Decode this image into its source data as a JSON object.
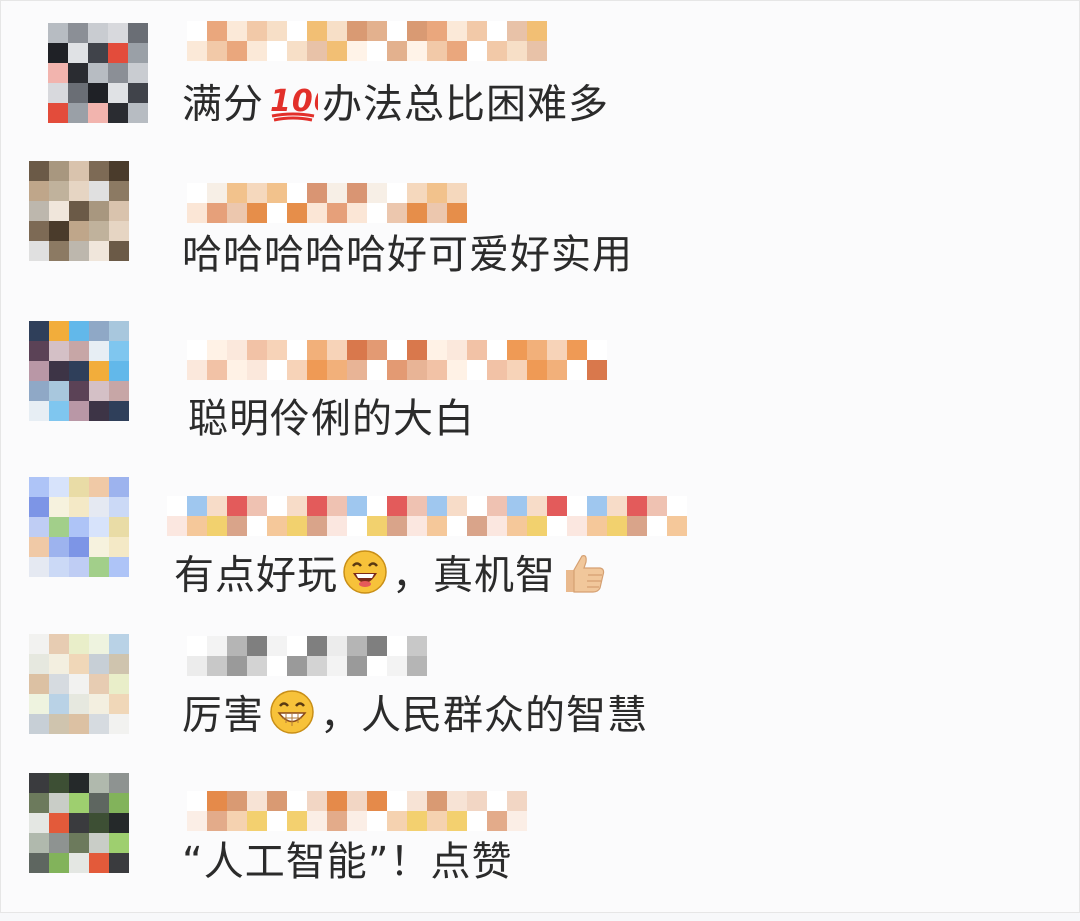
{
  "comments": [
    {
      "text_before": "满分",
      "emoji": "hundred-points",
      "text_after": "办法总比困难多"
    },
    {
      "text_before": "哈哈哈哈哈好可爱好实用",
      "emoji": "",
      "text_after": ""
    },
    {
      "text_before": "聪明伶俐的大白",
      "emoji": "",
      "text_after": ""
    },
    {
      "text_before": "有点好玩",
      "emoji": "laughing-face",
      "text_after": "，真机智",
      "emoji2": "thumbs-up"
    },
    {
      "text_before": "厉害",
      "emoji": "grinning-face",
      "text_after": "，人民群众的智慧"
    },
    {
      "text_before": "“人工智能”！点赞",
      "emoji": "",
      "text_after": ""
    }
  ],
  "colors": {
    "text": "#2b2b2b",
    "background": "#fbfbfc",
    "emoji_yellow": "#f7c23a",
    "hundred_red": "#e2302a",
    "thumb_skin": "#f1c79b"
  },
  "avatar_palettes": [
    [
      "#b7bcc2",
      "#1f2126",
      "#40434a",
      "#9aa0a7",
      "#c9ccd1",
      "#6a6e75",
      "#e0e2e5",
      "#2a2c31",
      "#8b8f96",
      "#d8d9dd",
      "#e34c3b",
      "#f2b4ae"
    ],
    [
      "#6b5a47",
      "#bfa68a",
      "#e6d5c3",
      "#8c7a63",
      "#d9c3ad",
      "#4a3b2b",
      "#c0b29c",
      "#f0e6db",
      "#a8977f",
      "#7d6a55",
      "#e0e0e0",
      "#bdb7ad"
    ],
    [
      "#2f3f5a",
      "#5b4256",
      "#c7a6a6",
      "#7fc6ef",
      "#62b8ea",
      "#a8c7dd",
      "#d4c0c6",
      "#3d3446",
      "#f2ad3b",
      "#8fa8c6",
      "#e7eef4",
      "#b997a6"
    ],
    [
      "#aec4f7",
      "#7d95e6",
      "#f4e9c6",
      "#cbd9f6",
      "#e9dca6",
      "#9db3ee",
      "#f6f2de",
      "#a2cf8a",
      "#d7e3fb",
      "#f0c9a6",
      "#e5e9f2",
      "#bfcdf4"
    ],
    [
      "#f2f2f0",
      "#e6e8df",
      "#f0d7b8",
      "#cfc4ae",
      "#e9eec9",
      "#b9d2e6",
      "#f3efe0",
      "#d6dbe0",
      "#e7ccb2",
      "#eef3df",
      "#c7cfd6",
      "#dcc1a3"
    ],
    [
      "#3a3b3e",
      "#6c7a5c",
      "#9ecf6f",
      "#82b35b",
      "#25292a",
      "#8e9391",
      "#c9cdc7",
      "#e35a3a",
      "#3d4f34",
      "#b0b9ad",
      "#5e6660",
      "#e4e7e3"
    ]
  ],
  "nick_palettes": [
    [
      "#f2c9a8",
      "#e3b18e",
      "#f7dfc7",
      "#fbe9d8",
      "#d99a73",
      "#f2bf74",
      "#eaa77d",
      "#fff3e8",
      "#e8c2a8"
    ],
    [
      "#d99573",
      "#e6a07a",
      "#f5d8bd",
      "#fbe6d6",
      "#f2c28c",
      "#e68e4a",
      "#f7efe6",
      "#ecc7ae"
    ],
    [
      "#f2c2a6",
      "#e39a73",
      "#f7d3b8",
      "#fbe8dc",
      "#d9784c",
      "#f2b07a",
      "#fff2e6",
      "#e8b496",
      "#ef9a55"
    ],
    [
      "#efc2b2",
      "#d9a48a",
      "#f7dcc8",
      "#fbe7e0",
      "#e7a27e",
      "#f2d16e",
      "#9fc7ef",
      "#c6dcf5",
      "#e35b5b",
      "#f5c89a"
    ],
    [
      "#d3d3d3",
      "#9a9a9a",
      "#c8c8c8",
      "#ececec",
      "#7f7f7f",
      "#b5b5b5",
      "#f3f3f3"
    ],
    [
      "#f2d6c4",
      "#e3ab8a",
      "#f7e3d5",
      "#fbeee6",
      "#d99a73",
      "#f3d06f",
      "#e58a4a",
      "#f5d2b0"
    ]
  ]
}
